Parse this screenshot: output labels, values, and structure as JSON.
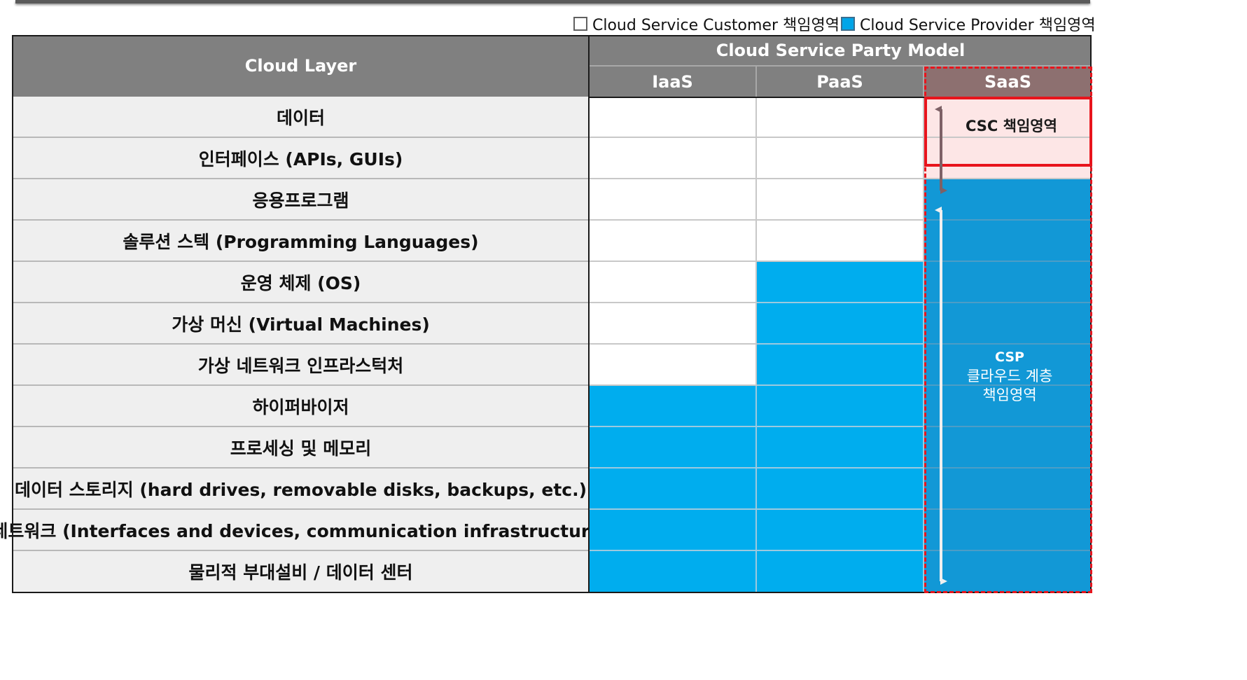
{
  "legend": {
    "customer_label": "Cloud Service Customer 책임영역",
    "provider_label": "Cloud Service Provider 책임영역"
  },
  "header": {
    "layer_title": "Cloud Layer",
    "model_title": "Cloud Service Party Model",
    "models": [
      "IaaS",
      "PaaS",
      "SaaS"
    ]
  },
  "layers": [
    "데이터",
    "인터페이스 (APIs, GUIs)",
    "응용프로그램",
    "솔루션 스텍 (Programming Languages)",
    "운영 체제 (OS)",
    "가상 머신 (Virtual Machines)",
    "가상 네트워크 인프라스턱처",
    "하이퍼바이저",
    "프로세싱 및 메모리",
    "데이터 스토리지 (hard drives, removable disks, backups, etc.)",
    "네트워크 (Interfaces and devices, communication infrastructure)",
    "물리적 부대설비 / 데이터 센터"
  ],
  "responsibility": {
    "iaas_customer_layer_count": 7,
    "paas_customer_layer_count": 4,
    "saas_customer_layer_count": 2
  },
  "annotations": {
    "csc_label": "CSC 책임영역",
    "csp_line1": "CSP",
    "csp_line2": "클라우드 계층",
    "csp_line3": "책임영역"
  },
  "colors": {
    "header_gray": "#808080",
    "layer_bg": "#efefef",
    "provider_blue": "#00adee",
    "saas_blue": "#1298d6",
    "csc_pink": "#fde6e6",
    "highlight_red": "#e8141c",
    "arrow_gray": "#7d6166"
  }
}
